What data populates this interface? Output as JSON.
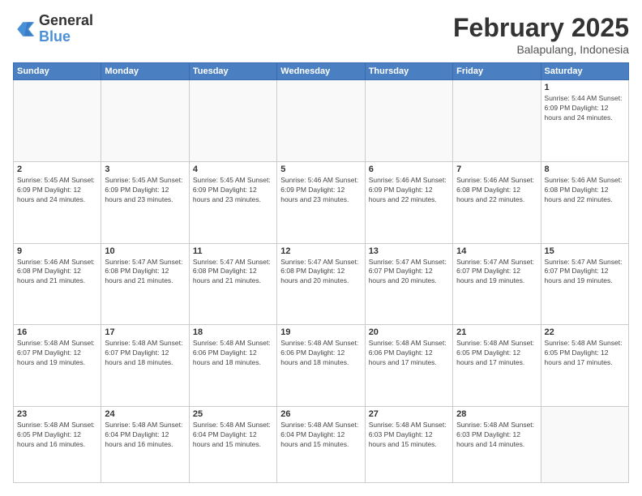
{
  "header": {
    "logo_general": "General",
    "logo_blue": "Blue",
    "month_title": "February 2025",
    "location": "Balapulang, Indonesia"
  },
  "weekdays": [
    "Sunday",
    "Monday",
    "Tuesday",
    "Wednesday",
    "Thursday",
    "Friday",
    "Saturday"
  ],
  "weeks": [
    [
      {
        "day": "",
        "info": ""
      },
      {
        "day": "",
        "info": ""
      },
      {
        "day": "",
        "info": ""
      },
      {
        "day": "",
        "info": ""
      },
      {
        "day": "",
        "info": ""
      },
      {
        "day": "",
        "info": ""
      },
      {
        "day": "1",
        "info": "Sunrise: 5:44 AM\nSunset: 6:09 PM\nDaylight: 12 hours\nand 24 minutes."
      }
    ],
    [
      {
        "day": "2",
        "info": "Sunrise: 5:45 AM\nSunset: 6:09 PM\nDaylight: 12 hours\nand 24 minutes."
      },
      {
        "day": "3",
        "info": "Sunrise: 5:45 AM\nSunset: 6:09 PM\nDaylight: 12 hours\nand 23 minutes."
      },
      {
        "day": "4",
        "info": "Sunrise: 5:45 AM\nSunset: 6:09 PM\nDaylight: 12 hours\nand 23 minutes."
      },
      {
        "day": "5",
        "info": "Sunrise: 5:46 AM\nSunset: 6:09 PM\nDaylight: 12 hours\nand 23 minutes."
      },
      {
        "day": "6",
        "info": "Sunrise: 5:46 AM\nSunset: 6:09 PM\nDaylight: 12 hours\nand 22 minutes."
      },
      {
        "day": "7",
        "info": "Sunrise: 5:46 AM\nSunset: 6:08 PM\nDaylight: 12 hours\nand 22 minutes."
      },
      {
        "day": "8",
        "info": "Sunrise: 5:46 AM\nSunset: 6:08 PM\nDaylight: 12 hours\nand 22 minutes."
      }
    ],
    [
      {
        "day": "9",
        "info": "Sunrise: 5:46 AM\nSunset: 6:08 PM\nDaylight: 12 hours\nand 21 minutes."
      },
      {
        "day": "10",
        "info": "Sunrise: 5:47 AM\nSunset: 6:08 PM\nDaylight: 12 hours\nand 21 minutes."
      },
      {
        "day": "11",
        "info": "Sunrise: 5:47 AM\nSunset: 6:08 PM\nDaylight: 12 hours\nand 21 minutes."
      },
      {
        "day": "12",
        "info": "Sunrise: 5:47 AM\nSunset: 6:08 PM\nDaylight: 12 hours\nand 20 minutes."
      },
      {
        "day": "13",
        "info": "Sunrise: 5:47 AM\nSunset: 6:07 PM\nDaylight: 12 hours\nand 20 minutes."
      },
      {
        "day": "14",
        "info": "Sunrise: 5:47 AM\nSunset: 6:07 PM\nDaylight: 12 hours\nand 19 minutes."
      },
      {
        "day": "15",
        "info": "Sunrise: 5:47 AM\nSunset: 6:07 PM\nDaylight: 12 hours\nand 19 minutes."
      }
    ],
    [
      {
        "day": "16",
        "info": "Sunrise: 5:48 AM\nSunset: 6:07 PM\nDaylight: 12 hours\nand 19 minutes."
      },
      {
        "day": "17",
        "info": "Sunrise: 5:48 AM\nSunset: 6:07 PM\nDaylight: 12 hours\nand 18 minutes."
      },
      {
        "day": "18",
        "info": "Sunrise: 5:48 AM\nSunset: 6:06 PM\nDaylight: 12 hours\nand 18 minutes."
      },
      {
        "day": "19",
        "info": "Sunrise: 5:48 AM\nSunset: 6:06 PM\nDaylight: 12 hours\nand 18 minutes."
      },
      {
        "day": "20",
        "info": "Sunrise: 5:48 AM\nSunset: 6:06 PM\nDaylight: 12 hours\nand 17 minutes."
      },
      {
        "day": "21",
        "info": "Sunrise: 5:48 AM\nSunset: 6:05 PM\nDaylight: 12 hours\nand 17 minutes."
      },
      {
        "day": "22",
        "info": "Sunrise: 5:48 AM\nSunset: 6:05 PM\nDaylight: 12 hours\nand 17 minutes."
      }
    ],
    [
      {
        "day": "23",
        "info": "Sunrise: 5:48 AM\nSunset: 6:05 PM\nDaylight: 12 hours\nand 16 minutes."
      },
      {
        "day": "24",
        "info": "Sunrise: 5:48 AM\nSunset: 6:04 PM\nDaylight: 12 hours\nand 16 minutes."
      },
      {
        "day": "25",
        "info": "Sunrise: 5:48 AM\nSunset: 6:04 PM\nDaylight: 12 hours\nand 15 minutes."
      },
      {
        "day": "26",
        "info": "Sunrise: 5:48 AM\nSunset: 6:04 PM\nDaylight: 12 hours\nand 15 minutes."
      },
      {
        "day": "27",
        "info": "Sunrise: 5:48 AM\nSunset: 6:03 PM\nDaylight: 12 hours\nand 15 minutes."
      },
      {
        "day": "28",
        "info": "Sunrise: 5:48 AM\nSunset: 6:03 PM\nDaylight: 12 hours\nand 14 minutes."
      },
      {
        "day": "",
        "info": ""
      }
    ]
  ]
}
